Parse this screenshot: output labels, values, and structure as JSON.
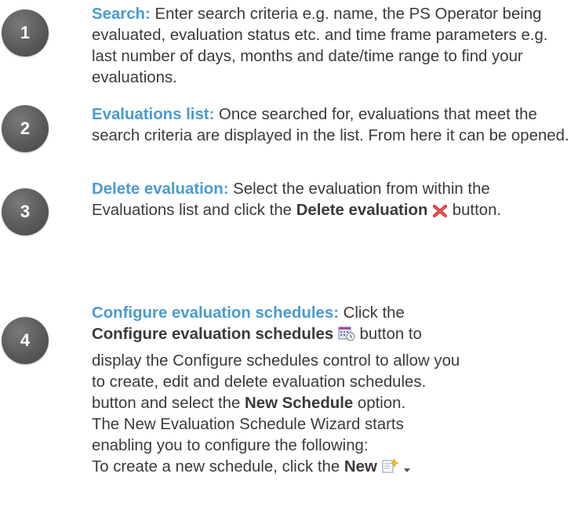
{
  "steps": [
    {
      "number": "1",
      "title": "Search:",
      "body": " Enter search criteria e.g. name, the PS Operator being evaluated, evaluation status etc. and time frame parameters e.g. last number of days, months and date/time range to find your evaluations."
    },
    {
      "number": "2",
      "title": "Evaluations list:",
      "body": " Once searched for, evaluations that meet the search criteria are displayed in the list. From here it can be opened."
    },
    {
      "number": "3",
      "title": "Delete evaluation:",
      "body_before": " Select the evaluation from within the Evaluations list and click the ",
      "bold": "Delete evaluation",
      "icon": "red-x-delete-icon",
      "body_after": " button."
    },
    {
      "number": "4",
      "title": "Configure evaluation schedules:",
      "line1_rest": " Click the",
      "bold": "Configure evaluation schedules",
      "icon": "calendar-schedule-icon",
      "line2_rest": " button to",
      "para2": "display the Configure schedules control to allow you to create, edit and delete evaluation schedules.",
      "para3_before": "button and select the ",
      "para3_bold": "New Schedule",
      "para3_after": " option. The New Evaluation Schedule Wizard starts enabling you to configure the following:",
      "para4_before": "To create a new schedule, click the ",
      "para4_bold": "New",
      "para4_icon": "new-item-sparkle-icon",
      "para4_dropdown_icon": "dropdown-arrow-icon"
    }
  ],
  "colors": {
    "title": "#4a9bd0",
    "text": "#3a3a3a",
    "badge": "#5a5a5a",
    "delete_icon": "#d02a2a"
  }
}
